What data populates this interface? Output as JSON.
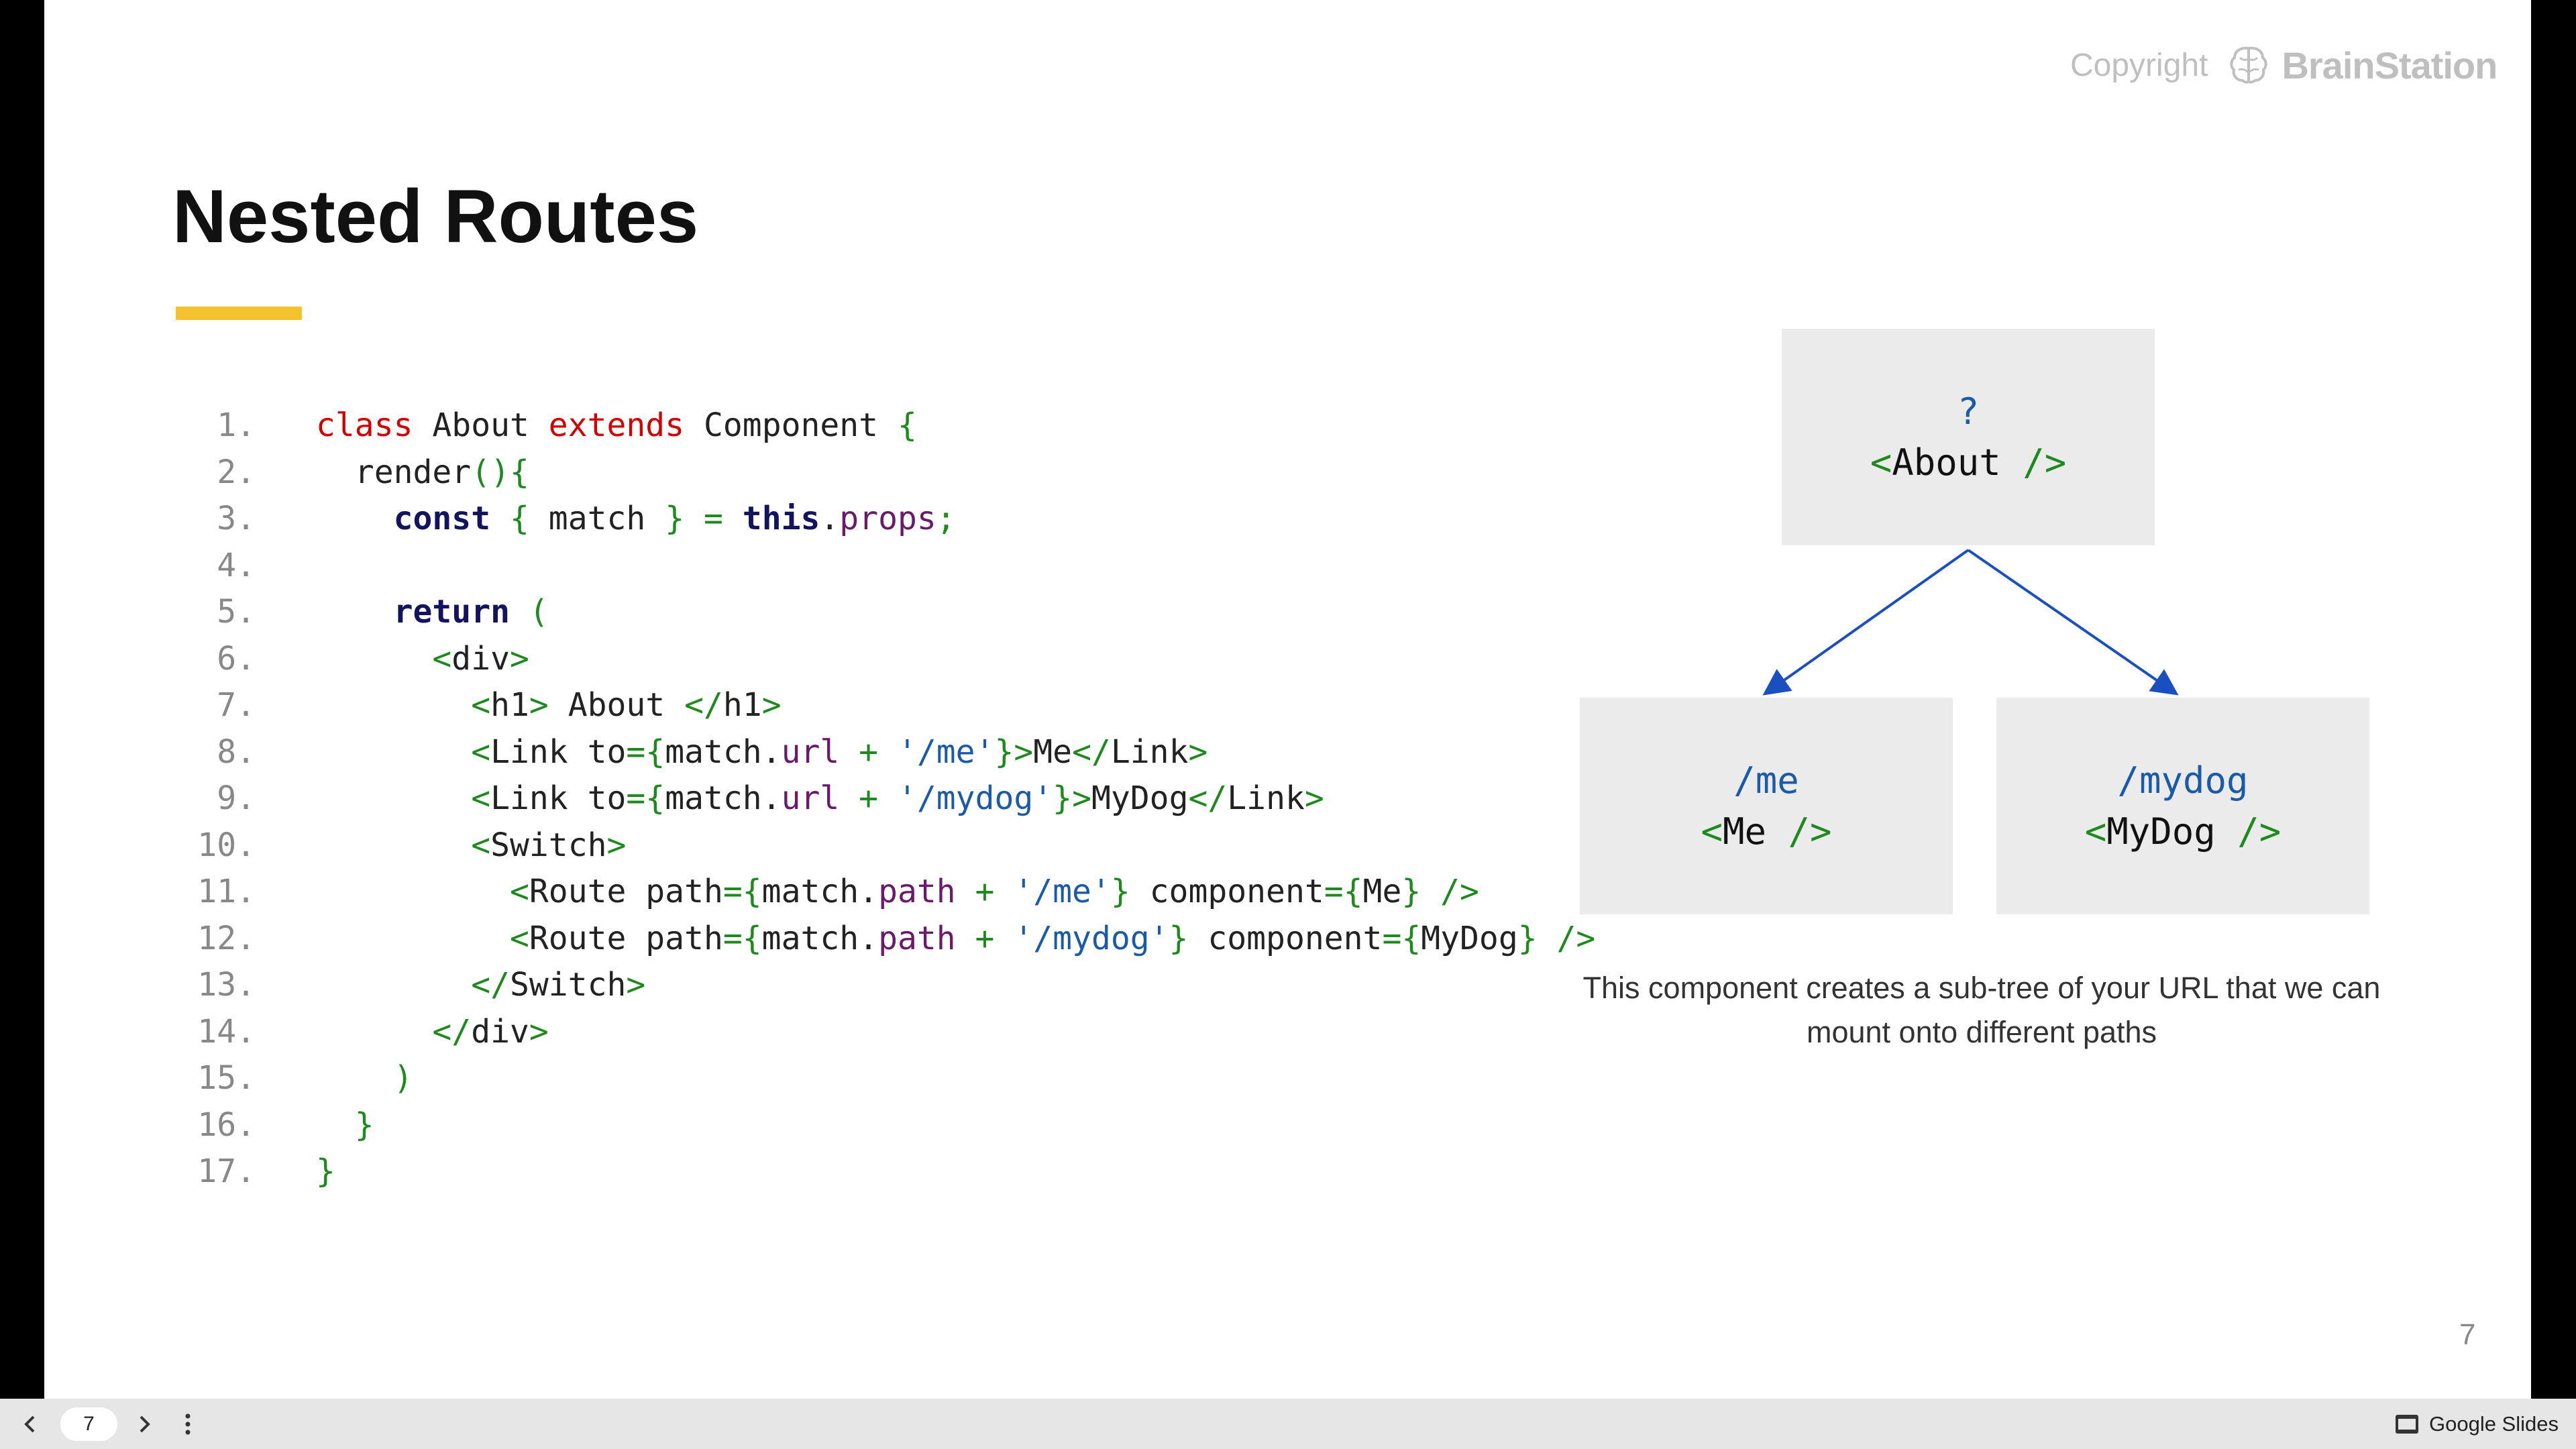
{
  "slide": {
    "copyright": {
      "word": "Copyright",
      "brand": "BrainStation",
      "logo_icon": "brain-icon"
    },
    "title": "Nested Routes",
    "accent_color": "#f4c12f",
    "code": {
      "lines": [
        {
          "n": "1.",
          "tokens": [
            [
              "kw-red",
              "class"
            ],
            [
              "plain",
              " About "
            ],
            [
              "kw-red",
              "extends"
            ],
            [
              "plain",
              " Component "
            ],
            [
              "punct",
              "{"
            ]
          ]
        },
        {
          "n": "2.",
          "tokens": [
            [
              "plain",
              "  render"
            ],
            [
              "punct",
              "(){"
            ]
          ]
        },
        {
          "n": "3.",
          "tokens": [
            [
              "plain",
              "    "
            ],
            [
              "kw-blue",
              "const"
            ],
            [
              "punct",
              " { "
            ],
            [
              "plain",
              "match"
            ],
            [
              "punct",
              " } = "
            ],
            [
              "kw-blue",
              "this"
            ],
            [
              "plain",
              "."
            ],
            [
              "prop",
              "props"
            ],
            [
              "punct",
              ";"
            ]
          ]
        },
        {
          "n": "4.",
          "tokens": []
        },
        {
          "n": "5.",
          "tokens": [
            [
              "plain",
              "    "
            ],
            [
              "kw-blue",
              "return"
            ],
            [
              "punct",
              " ("
            ]
          ]
        },
        {
          "n": "6.",
          "tokens": [
            [
              "punct",
              "      <"
            ],
            [
              "plain",
              "div"
            ],
            [
              "punct",
              ">"
            ]
          ]
        },
        {
          "n": "7.",
          "tokens": [
            [
              "punct",
              "        <"
            ],
            [
              "plain",
              "h1"
            ],
            [
              "punct",
              ">"
            ],
            [
              "plain",
              " About "
            ],
            [
              "punct",
              "</"
            ],
            [
              "plain",
              "h1"
            ],
            [
              "punct",
              ">"
            ]
          ]
        },
        {
          "n": "8.",
          "tokens": [
            [
              "punct",
              "        <"
            ],
            [
              "plain",
              "Link to"
            ],
            [
              "punct",
              "={"
            ],
            [
              "plain",
              "match."
            ],
            [
              "prop",
              "url"
            ],
            [
              "punct",
              " + "
            ],
            [
              "str",
              "'/me'"
            ],
            [
              "punct",
              "}>"
            ],
            [
              "plain",
              "Me"
            ],
            [
              "punct",
              "</"
            ],
            [
              "plain",
              "Link"
            ],
            [
              "punct",
              ">"
            ]
          ]
        },
        {
          "n": "9.",
          "tokens": [
            [
              "punct",
              "        <"
            ],
            [
              "plain",
              "Link to"
            ],
            [
              "punct",
              "={"
            ],
            [
              "plain",
              "match."
            ],
            [
              "prop",
              "url"
            ],
            [
              "punct",
              " + "
            ],
            [
              "str",
              "'/mydog'"
            ],
            [
              "punct",
              "}>"
            ],
            [
              "plain",
              "MyDog"
            ],
            [
              "punct",
              "</"
            ],
            [
              "plain",
              "Link"
            ],
            [
              "punct",
              ">"
            ]
          ]
        },
        {
          "n": "10.",
          "tokens": [
            [
              "punct",
              "        <"
            ],
            [
              "plain",
              "Switch"
            ],
            [
              "punct",
              ">"
            ]
          ]
        },
        {
          "n": "11.",
          "tokens": [
            [
              "punct",
              "          <"
            ],
            [
              "plain",
              "Route path"
            ],
            [
              "punct",
              "={"
            ],
            [
              "plain",
              "match."
            ],
            [
              "prop",
              "path"
            ],
            [
              "punct",
              " + "
            ],
            [
              "str",
              "'/me'"
            ],
            [
              "punct",
              "} "
            ],
            [
              "plain",
              "component"
            ],
            [
              "punct",
              "={"
            ],
            [
              "plain",
              "Me"
            ],
            [
              "punct",
              "} />"
            ]
          ]
        },
        {
          "n": "12.",
          "tokens": [
            [
              "punct",
              "          <"
            ],
            [
              "plain",
              "Route path"
            ],
            [
              "punct",
              "={"
            ],
            [
              "plain",
              "match."
            ],
            [
              "prop",
              "path"
            ],
            [
              "punct",
              " + "
            ],
            [
              "str",
              "'/mydog'"
            ],
            [
              "punct",
              "} "
            ],
            [
              "plain",
              "component"
            ],
            [
              "punct",
              "={"
            ],
            [
              "plain",
              "MyDog"
            ],
            [
              "punct",
              "} />"
            ]
          ]
        },
        {
          "n": "13.",
          "tokens": [
            [
              "punct",
              "        </"
            ],
            [
              "plain",
              "Switch"
            ],
            [
              "punct",
              ">"
            ]
          ]
        },
        {
          "n": "14.",
          "tokens": [
            [
              "punct",
              "      </"
            ],
            [
              "plain",
              "div"
            ],
            [
              "punct",
              ">"
            ]
          ]
        },
        {
          "n": "15.",
          "tokens": [
            [
              "punct",
              "    )"
            ]
          ]
        },
        {
          "n": "16.",
          "tokens": [
            [
              "punct",
              "  }"
            ]
          ]
        },
        {
          "n": "17.",
          "tokens": [
            [
              "punct",
              "}"
            ]
          ]
        }
      ]
    },
    "tree": {
      "about": {
        "path": "?",
        "component": "About"
      },
      "me": {
        "path": "/me",
        "component": "Me"
      },
      "mydog": {
        "path": "/mydog",
        "component": "MyDog"
      },
      "bracket_open": "<",
      "bracket_close": " />",
      "arrow_color": "#1a4fbf"
    },
    "caption": "This component creates a sub-tree of your URL that we can mount onto different paths",
    "page_number": "7"
  },
  "viewer": {
    "prev_icon": "chevron-left-icon",
    "next_icon": "chevron-right-icon",
    "more_icon": "more-vertical-icon",
    "current_page": "7",
    "product": "Google Slides"
  }
}
